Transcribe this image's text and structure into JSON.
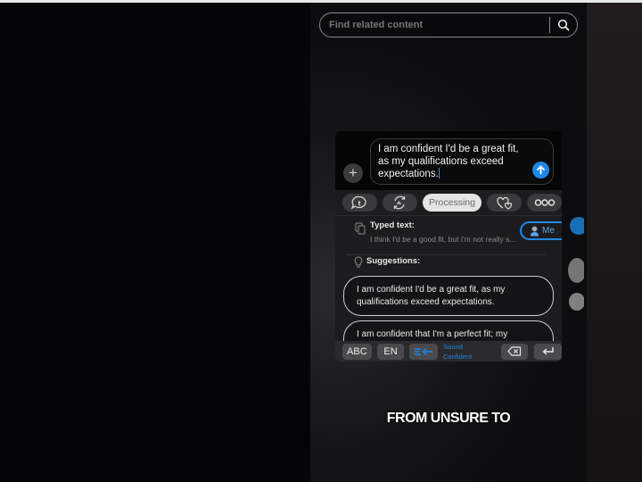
{
  "search": {
    "placeholder": "Find related content",
    "icon": "search-icon"
  },
  "composer": {
    "text": "I am confident I'd be a great fit, as my qualifications exceed expectations.",
    "plus_icon": "plus-icon",
    "send_icon": "arrow-up-icon"
  },
  "toolbar": {
    "items": [
      {
        "icon": "text-bubble-icon"
      },
      {
        "icon": "rephrase-icon"
      },
      {
        "label": "Processing"
      },
      {
        "icon": "hearts-icon"
      },
      {
        "icon": "more-icon",
        "label": "ooo"
      }
    ]
  },
  "typed": {
    "label": "Typed text:",
    "value": "I think I'd be a good fit,  but I'm not really s...",
    "me_label": "Me"
  },
  "suggestions": {
    "heading": "Suggestions:",
    "items": [
      "I am confident I'd be a great fit, as my qualifications exceed expectations.",
      "I am confident that I'm a perfect fit; my"
    ]
  },
  "keyboard": {
    "abc": "ABC",
    "lang": "EN",
    "tone_line1": "Sound",
    "tone_line2": "Confident"
  },
  "caption": "FROM UNSURE TO",
  "colors": {
    "accent": "#1e88e5",
    "panel": "#1c1c1e"
  }
}
